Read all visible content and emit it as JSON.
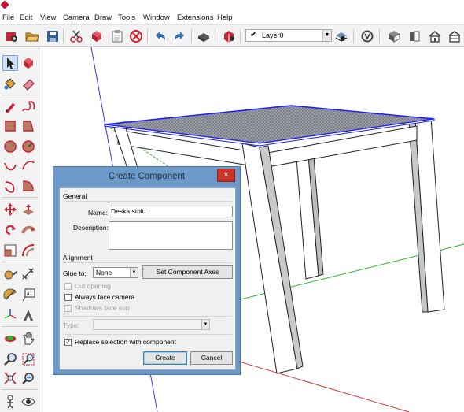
{
  "menubar": {
    "items": [
      "File",
      "Edit",
      "View",
      "Camera",
      "Draw",
      "Tools",
      "Window",
      "Extensions",
      "Help"
    ]
  },
  "toolbar": {
    "layer_selected": "Layer0",
    "buttons": [
      "getting-started",
      "open",
      "save",
      "cut",
      "make-component",
      "paste",
      "erase",
      "undo",
      "redo",
      "print",
      "3d-warehouse",
      "layer-manager",
      "vray",
      "iso-view",
      "front-view",
      "home-view",
      "back-view"
    ]
  },
  "left_tools": [
    "select",
    "make-component",
    "paint-bucket",
    "eraser",
    "line",
    "freehand",
    "rectangle",
    "rotated-rectangle",
    "circle",
    "polygon",
    "arc",
    "pie",
    "three-point-arc",
    "two-point-arc",
    "move",
    "push-pull",
    "rotate",
    "follow-me",
    "scale",
    "offset",
    "tape-measure",
    "dimension",
    "protractor",
    "text",
    "axes",
    "3d-text",
    "orbit",
    "pan",
    "zoom",
    "zoom-window",
    "zoom-extents",
    "previous",
    "position-camera",
    "look-around"
  ],
  "dialog": {
    "title": "Create Component",
    "close_label": "×",
    "general_heading": "General",
    "name_label": "Name:",
    "name_value": "Deska stolu",
    "description_label": "Description:",
    "description_value": "",
    "alignment_heading": "Alignment",
    "glue_label": "Glue to:",
    "glue_value": "None",
    "set_axes_label": "Set Component Axes",
    "cut_opening_label": "Cut opening",
    "always_face_camera_label": "Always face camera",
    "shadows_face_sun_label": "Shadows face sun",
    "type_label": "Type:",
    "type_value": "",
    "replace_label": "Replace selection with component",
    "create_label": "Create",
    "cancel_label": "Cancel",
    "always_face_camera_checked": false,
    "replace_checked": true
  },
  "colors": {
    "dialog_frame": "#6d9ac9",
    "close_button": "#c9352b",
    "selection_blue": "#1a1aff",
    "axis_red": "#d63b3b",
    "axis_green": "#2fb52f",
    "axis_blue": "#3a3ad6"
  }
}
